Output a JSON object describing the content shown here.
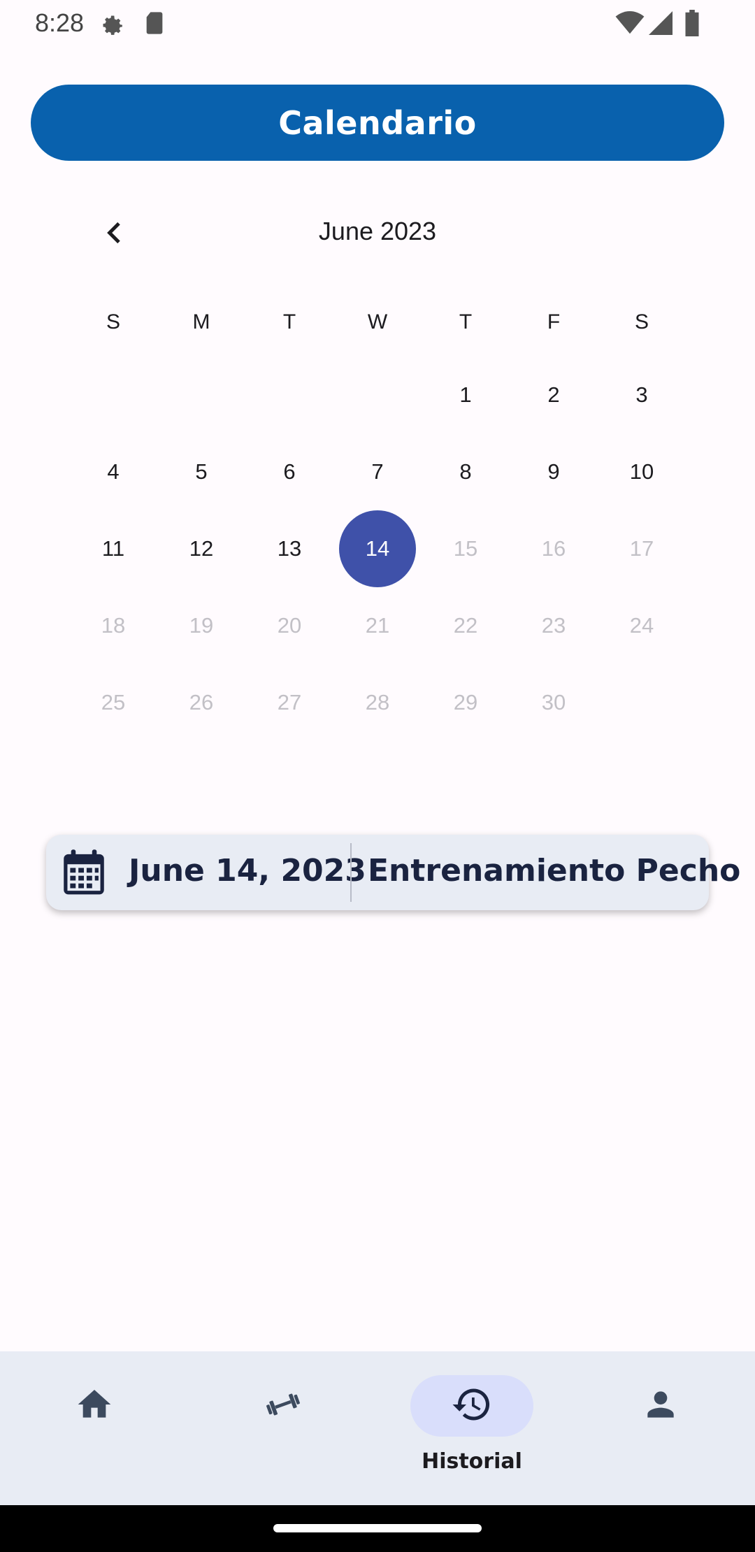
{
  "status_bar": {
    "time": "8:28",
    "icons": [
      "settings-icon",
      "sd-card-icon",
      "wifi-icon",
      "signal-icon",
      "battery-icon"
    ]
  },
  "header": {
    "title": "Calendario"
  },
  "calendar": {
    "month_label": "June 2023",
    "weekdays": [
      "S",
      "M",
      "T",
      "W",
      "T",
      "F",
      "S"
    ],
    "weeks": [
      [
        "",
        "",
        "",
        "",
        "1",
        "2",
        "3"
      ],
      [
        "4",
        "5",
        "6",
        "7",
        "8",
        "9",
        "10"
      ],
      [
        "11",
        "12",
        "13",
        "14",
        "15",
        "16",
        "17"
      ],
      [
        "18",
        "19",
        "20",
        "21",
        "22",
        "23",
        "24"
      ],
      [
        "25",
        "26",
        "27",
        "28",
        "29",
        "30",
        ""
      ]
    ],
    "selected_day": "14",
    "last_enabled_day": 14,
    "colors": {
      "selected": "#3f51a9",
      "disabled_text": "#c2c0c6"
    }
  },
  "entry": {
    "date": "June 14, 2023",
    "title": "Entrenamiento Pecho",
    "icon": "calendar-icon"
  },
  "bottom_nav": {
    "items": [
      {
        "name": "home",
        "icon": "home-icon",
        "label": ""
      },
      {
        "name": "workouts",
        "icon": "dumbbell-icon",
        "label": ""
      },
      {
        "name": "history",
        "icon": "history-icon",
        "label": "Historial",
        "active": true
      },
      {
        "name": "profile",
        "icon": "person-icon",
        "label": ""
      }
    ]
  },
  "colors": {
    "brand": "#0961ad",
    "nav_background": "#e8ecf4",
    "active_pill": "#d9defb"
  }
}
